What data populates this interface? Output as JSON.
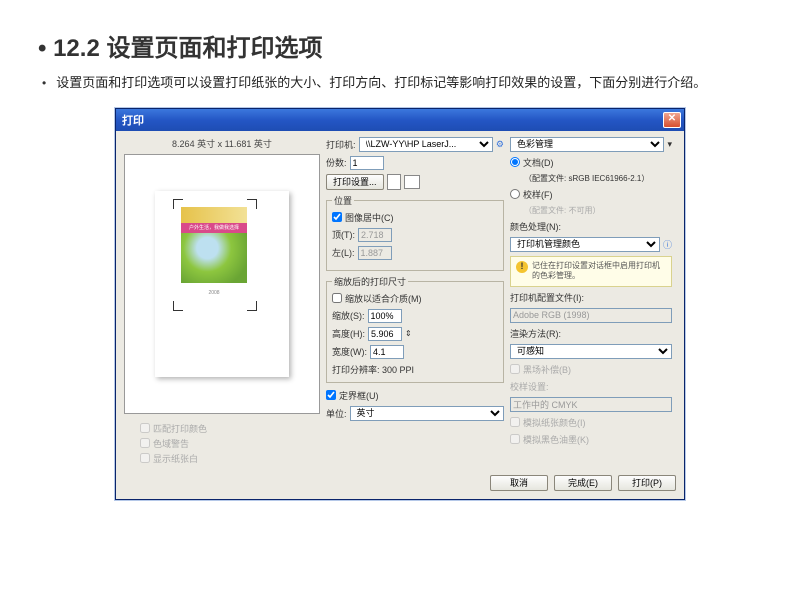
{
  "heading": "12.2 设置页面和打印选项",
  "description": "设置页面和打印选项可以设置打印纸张的大小、打印方向、打印标记等影响打印效果的设置，下面分别进行介绍。",
  "dialog": {
    "title": "打印",
    "preview_size": "8.264 英寸 x 11.681 英寸",
    "banner_text": "户外生活，我做我选择",
    "logo_text": "2008",
    "preview_opts": {
      "o1": "匹配打印颜色",
      "o2": "色域警告",
      "o3": "显示纸张白"
    },
    "printer": {
      "label": "打印机:",
      "value": "\\\\LZW-YY\\HP LaserJ..."
    },
    "copies": {
      "label": "份数:",
      "value": "1"
    },
    "page_setup_btn": "打印设置...",
    "position": {
      "legend": "位置",
      "center": "图像居中(C)",
      "top_label": "顶(T):",
      "top_value": "2.718",
      "left_label": "左(L):",
      "left_value": "1.887"
    },
    "scaled": {
      "legend": "缩放后的打印尺寸",
      "fit_media": "缩放以适合介质(M)",
      "scale_label": "缩放(S):",
      "scale_value": "100%",
      "height_label": "高度(H):",
      "height_value": "5.906",
      "width_label": "宽度(W):",
      "width_value": "4.1",
      "resolution": "打印分辨率: 300 PPI"
    },
    "bounding": "定界框(U)",
    "units_label": "单位:",
    "units_value": "英寸",
    "color_mgmt": {
      "header": "色彩管理",
      "doc_radio": "文档(D)",
      "doc_profile": "（配置文件: sRGB IEC61966-2.1）",
      "proof_radio": "校样(F)",
      "proof_profile": "（配置文件: 不可用）",
      "handling_label": "颜色处理(N):",
      "handling_value": "打印机管理颜色",
      "warning": "记住在打印设置对话框中启用打印机的色彩管理。",
      "printer_profile_label": "打印机配置文件(I):",
      "printer_profile_value": "Adobe RGB (1998)",
      "intent_label": "渲染方法(R):",
      "intent_value": "可感知",
      "bpc": "黑场补偿(B)",
      "proof_setup_label": "校样设置:",
      "proof_setup_value": "工作中的 CMYK",
      "sim_paper": "模拟纸张颜色(I)",
      "sim_black": "模拟黑色油墨(K)"
    }
  },
  "footer": {
    "cancel": "取消",
    "done": "完成(E)",
    "print": "打印(P)"
  }
}
